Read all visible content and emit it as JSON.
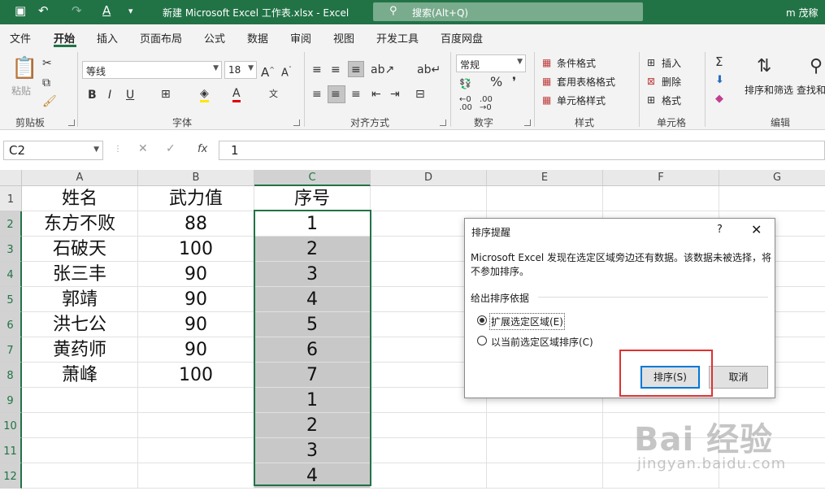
{
  "app": {
    "doc_title": "新建 Microsoft Excel 工作表.xlsx  -  Excel",
    "search_placeholder": "搜索(Alt+Q)",
    "user": "m 茂稼"
  },
  "menu_tabs": [
    "文件",
    "开始",
    "插入",
    "页面布局",
    "公式",
    "数据",
    "审阅",
    "视图",
    "开发工具",
    "百度网盘"
  ],
  "active_tab": "开始",
  "ribbon": {
    "clipboard": {
      "paste": "粘贴",
      "group": "剪贴板"
    },
    "font": {
      "name": "等线",
      "size": "18",
      "group": "字体"
    },
    "alignment": {
      "group": "对齐方式"
    },
    "number": {
      "format": "常规",
      "group": "数字"
    },
    "styles": {
      "conditional": "条件格式",
      "table": "套用表格格式",
      "cell": "单元格样式",
      "group": "样式"
    },
    "cells": {
      "insert": "插入",
      "delete": "删除",
      "format": "格式",
      "group": "单元格"
    },
    "editing": {
      "sort_filter": "排序和筛选",
      "find": "查找和",
      "group": "编辑"
    }
  },
  "formula_bar": {
    "name_box": "C2",
    "value": "1"
  },
  "sheet": {
    "columns": [
      "A",
      "B",
      "C",
      "D",
      "E",
      "F",
      "G"
    ],
    "rows": [
      [
        "姓名",
        "武力值",
        "序号"
      ],
      [
        "东方不败",
        "88",
        "1"
      ],
      [
        "石破天",
        "100",
        "2"
      ],
      [
        "张三丰",
        "90",
        "3"
      ],
      [
        "郭靖",
        "90",
        "4"
      ],
      [
        "洪七公",
        "90",
        "5"
      ],
      [
        "黄药师",
        "90",
        "6"
      ],
      [
        "萧峰",
        "100",
        "7"
      ],
      [
        "",
        "",
        "1"
      ],
      [
        "",
        "",
        "2"
      ],
      [
        "",
        "",
        "3"
      ],
      [
        "",
        "",
        "4"
      ]
    ]
  },
  "dialog": {
    "title": "排序提醒",
    "help": "?",
    "close": "✕",
    "message": "Microsoft Excel 发现在选定区域旁边还有数据。该数据未被选择，将不参加排序。",
    "section": "给出排序依据",
    "option_expand": "扩展选定区域(E)",
    "option_current": "以当前选定区域排序(C)",
    "selected_option": "expand",
    "sort_button": "排序(S)",
    "cancel_button": "取消"
  },
  "watermark": {
    "main": "Bai 经验",
    "sub": "jingyan.baidu.com"
  }
}
